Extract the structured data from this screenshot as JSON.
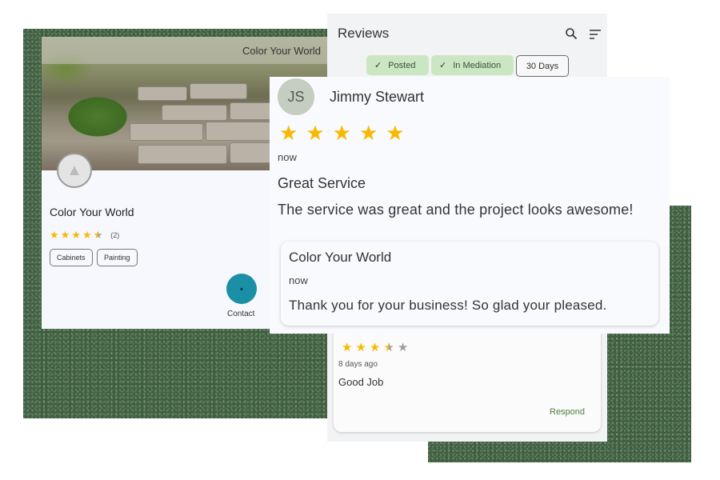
{
  "profile": {
    "hero_title": "Color Your World",
    "business_name": "Color Your World",
    "rating": 4.5,
    "review_count": "(2)",
    "categories": [
      "Cabinets",
      "Painting"
    ],
    "contact_label": "Contact"
  },
  "reviews": {
    "title": "Reviews",
    "filters": [
      {
        "label": "Posted",
        "selected": true
      },
      {
        "label": "In Mediation",
        "selected": true
      },
      {
        "label": "30 Days",
        "selected": false
      }
    ],
    "second_review": {
      "rating": 3.5,
      "time": "8 days ago",
      "title": "Good Job",
      "respond_label": "Respond"
    }
  },
  "detail": {
    "initials": "JS",
    "reviewer": "Jimmy Stewart",
    "rating": 5,
    "time": "now",
    "title": "Great Service",
    "body": "The service was great and the project looks awesome!",
    "response": {
      "name": "Color Your World",
      "time": "now",
      "body": "Thank you for your business! So glad your pleased."
    }
  },
  "colors": {
    "accent_green": "#cbe6c2",
    "star": "#f9b800",
    "contact_button": "#1b8fa6",
    "respond_text": "#4f7f3f"
  }
}
